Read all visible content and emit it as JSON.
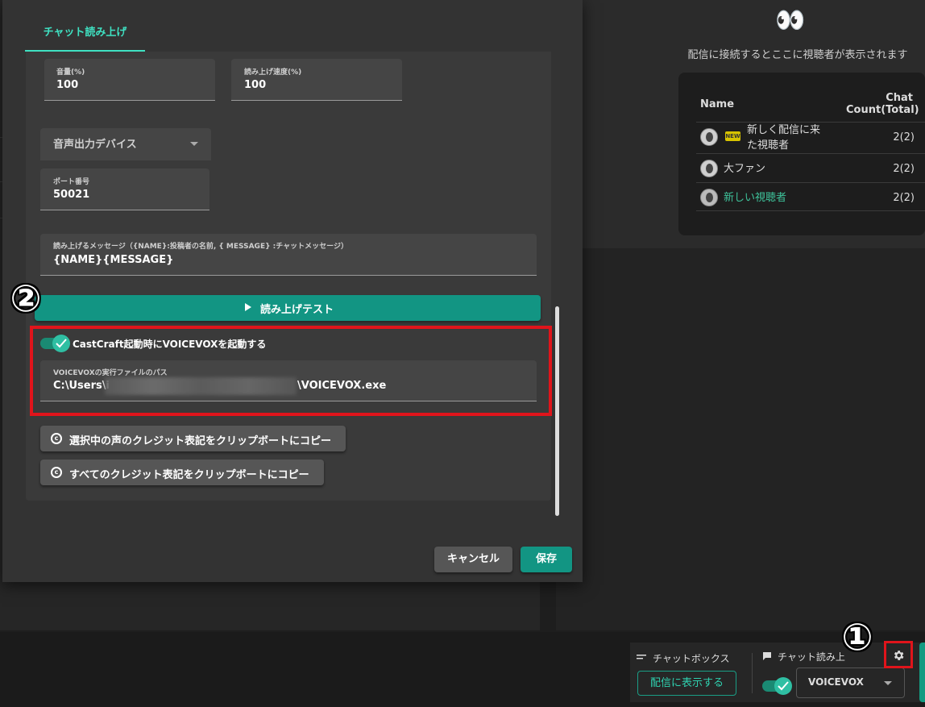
{
  "background": {
    "viewer_panel": {
      "emoji": "👀",
      "caption": "配信に接続するとここに視聴者が表示されます",
      "col_name": "Name",
      "col_count_line1": "Chat",
      "col_count_line2": "Count(Total)",
      "new_badge": "NEW",
      "viewers": [
        {
          "name_line1": "新しく配信に来",
          "name_line2": "た視聴者",
          "count": "2(2)"
        },
        {
          "name": "大ファン",
          "count": "2(2)"
        },
        {
          "name": "新しい視聴者",
          "count": "2(2)",
          "color": "#3ec29a"
        }
      ]
    },
    "bottom_bar": {
      "chatbox_label": "チャットボックス",
      "show_button": "配信に表示する",
      "reading_label": "チャット読み上",
      "select_value": "VOICEVOX"
    }
  },
  "modal": {
    "tab": "チャット読み上げ",
    "volume_label": "音量(%)",
    "volume_value": "100",
    "speed_label": "読み上げ速度(%)",
    "speed_value": "100",
    "device_select": "音声出力デバイス",
    "port_label": "ポート番号",
    "port_value": "50021",
    "message_label": "読み上げるメッセージ（{NAME}:投稿者の名前, { MESSAGE} :チャットメッセージ）",
    "message_value": "{NAME}{MESSAGE}",
    "test_button": "読み上げテスト",
    "autostart_label": "CastCraft起動時にVOICEVOXを起動する",
    "path_label": "VOICEVOXの実行ファイルのパス",
    "path_prefix": "C:\\Users\\i",
    "path_suffix": "\\VOICEVOX.exe",
    "credit_selected_button": "選択中の声のクレジット表記をクリップボートにコピー",
    "credit_all_button": "すべてのクレジット表記をクリップボートにコピー",
    "cancel_button": "キャンセル",
    "save_button": "保存"
  },
  "annotations": {
    "marker_1": "①",
    "marker_2": "②",
    "highlight_color": "#e0141b"
  },
  "colors": {
    "accent": "#129583",
    "accent_text": "#3fe1c2"
  }
}
